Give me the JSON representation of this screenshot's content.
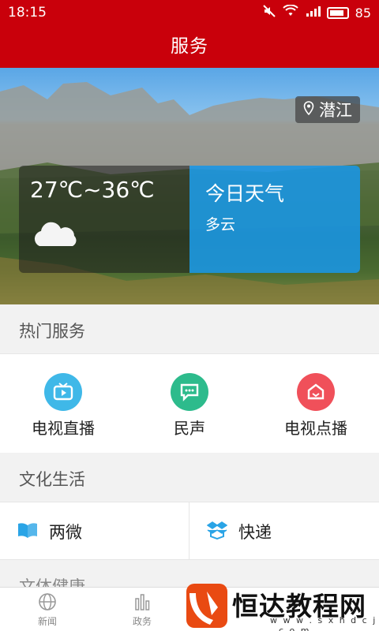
{
  "status_bar": {
    "time": "18:15",
    "battery_percent": "85",
    "battery_level": 0.85
  },
  "header": {
    "title": "服务"
  },
  "hero": {
    "location": "潜江",
    "temperature_range": "27℃~36℃",
    "weather_title": "今日天气",
    "weather_condition": "多云"
  },
  "hot_services": {
    "title": "热门服务",
    "items": [
      {
        "label": "电视直播",
        "icon": "tv-live-icon",
        "color": "#3fb8e8"
      },
      {
        "label": "民声",
        "icon": "chat-icon",
        "color": "#2dbb8c"
      },
      {
        "label": "电视点播",
        "icon": "vod-icon",
        "color": "#f0505a"
      }
    ]
  },
  "culture": {
    "title": "文化生活",
    "items": [
      {
        "label": "两微",
        "icon": "book-icon",
        "color": "#2aa4e6"
      },
      {
        "label": "快递",
        "icon": "package-icon",
        "color": "#2aa4e6"
      }
    ]
  },
  "partial_section": {
    "title": "文体健康"
  },
  "bottom_nav": {
    "items": [
      {
        "label": "新闻",
        "icon": "globe-icon"
      },
      {
        "label": "政务",
        "icon": "chart-icon"
      }
    ]
  },
  "watermark": {
    "text": "恒达教程网",
    "url": "w w w . s x h d c j . c o m"
  }
}
